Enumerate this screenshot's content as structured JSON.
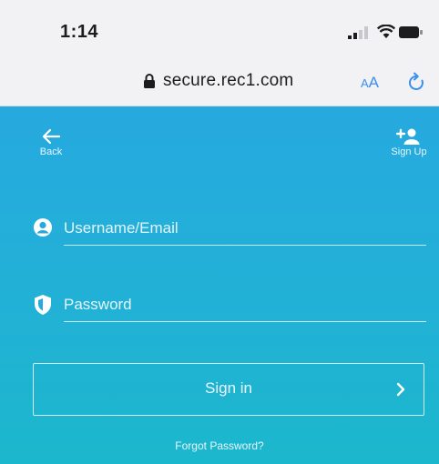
{
  "status_bar": {
    "time": "1:14",
    "icons": [
      "signal-icon",
      "wifi-icon",
      "battery-icon"
    ]
  },
  "address_bar": {
    "lock_icon": "lock-icon",
    "url": "secure.rec1.com",
    "text_size_small": "A",
    "text_size_large": "A",
    "reload_icon": "reload-icon"
  },
  "nav": {
    "back_label": "Back",
    "signup_label": "Sign Up"
  },
  "form": {
    "username_placeholder": "Username/Email",
    "username_value": "",
    "password_placeholder": "Password",
    "password_value": "",
    "signin_label": "Sign in",
    "forgot_label": "Forgot Password?"
  },
  "colors": {
    "accent": "#26a9df",
    "accent_bottom": "#1bb7cc",
    "link_blue": "#3a8ff0"
  }
}
